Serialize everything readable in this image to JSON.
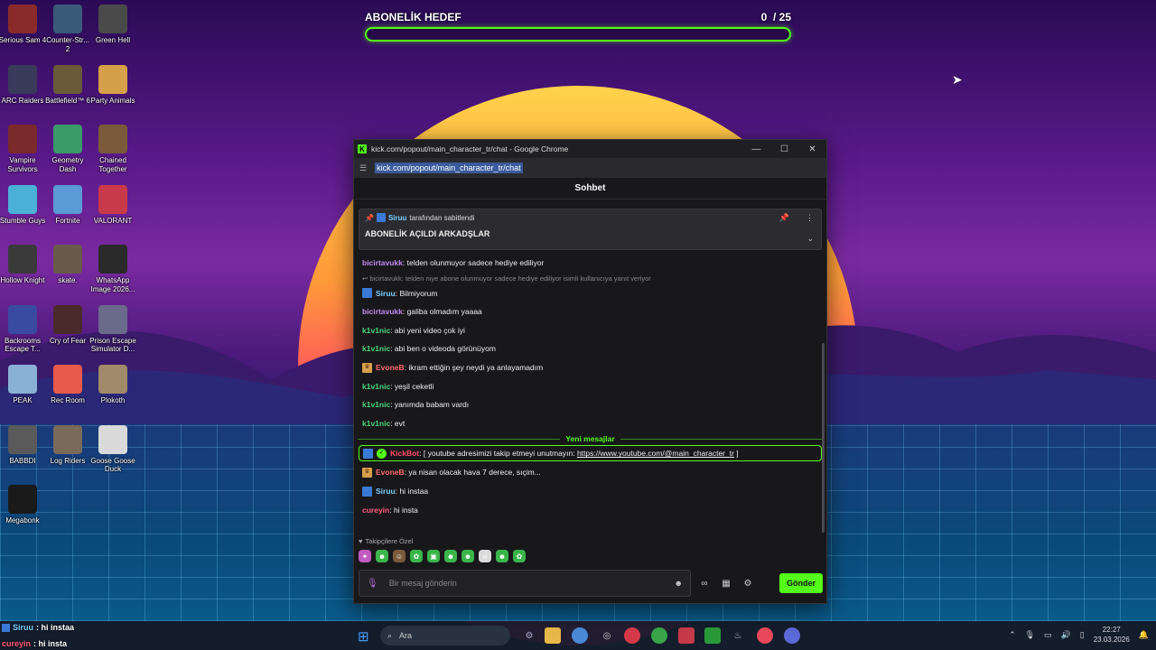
{
  "goal": {
    "title": "ABONELİK HEDEF",
    "current": "0",
    "target": "/ 25",
    "progress": 0
  },
  "desktop_icons": [
    {
      "label": "Serious Sam 4",
      "icon": "serious-sam-icon"
    },
    {
      "label": "Counter-Str... 2",
      "icon": "counter-strike-icon"
    },
    {
      "label": "Green Hell",
      "icon": "green-hell-icon"
    },
    {
      "label": "ARC Raiders",
      "icon": "arc-raiders-icon"
    },
    {
      "label": "Battlefield™ 6",
      "icon": "battlefield-icon"
    },
    {
      "label": "Party Animals",
      "icon": "party-animals-icon"
    },
    {
      "label": "Vampire Survivors",
      "icon": "vampire-survivors-icon"
    },
    {
      "label": "Geometry Dash",
      "icon": "geometry-dash-icon"
    },
    {
      "label": "Chained Together",
      "icon": "chained-together-icon"
    },
    {
      "label": "Stumble Guys",
      "icon": "stumble-guys-icon"
    },
    {
      "label": "Fortnite",
      "icon": "fortnite-icon"
    },
    {
      "label": "VALORANT",
      "icon": "valorant-icon"
    },
    {
      "label": "Hollow Knight",
      "icon": "hollow-knight-icon"
    },
    {
      "label": "skate.",
      "icon": "skate-icon"
    },
    {
      "label": "WhatsApp Image 2026...",
      "icon": "image-file-icon"
    },
    {
      "label": "Backrooms Escape T...",
      "icon": "backrooms-icon"
    },
    {
      "label": "Cry of Fear",
      "icon": "cry-of-fear-icon"
    },
    {
      "label": "Prison Escape Simulator D...",
      "icon": "prison-escape-icon"
    },
    {
      "label": "PEAK",
      "icon": "peak-icon"
    },
    {
      "label": "Rec Room",
      "icon": "rec-room-icon"
    },
    {
      "label": "Plokoth",
      "icon": "plokoth-icon"
    },
    {
      "label": "BABBDI",
      "icon": "babbdi-icon"
    },
    {
      "label": "Log Riders",
      "icon": "log-riders-icon"
    },
    {
      "label": "Goose Goose Duck",
      "icon": "goose-goose-duck-icon"
    },
    {
      "label": "Megabonk",
      "icon": "megabonk-icon"
    }
  ],
  "window": {
    "title": "kick.com/popout/main_character_tr/chat - Google Chrome",
    "url": "kick.com/popout/main_character_tr/chat",
    "chat_header": "Sohbet",
    "pinned": {
      "by_user": "Siruu",
      "by_suffix": "tarafından sabitlendi",
      "message": "ABONELİK AÇILDI ARKADŞLAR"
    },
    "messages": [
      {
        "user": "bicirtavukk",
        "color": "#c08af0",
        "text": ": telden olunmuyor sadece hediye ediliyor"
      },
      {
        "reply": "bicirtavukk: telden niye abone olunmuyor sadece hediye ediliyor isimli kullanıcıya yanıt veriyor"
      },
      {
        "user": "Siruu",
        "color": "#7ad0ff",
        "text": ": Bilmiyorum",
        "badge": "bot"
      },
      {
        "user": "bicirtavukk",
        "color": "#c08af0",
        "text": ": galiba olmadım yaaaa"
      },
      {
        "user": "k1v1nic",
        "color": "#4ad67a",
        "text": ": abi yeni video çok iyi"
      },
      {
        "user": "k1v1nic",
        "color": "#4ad67a",
        "text": ": abi ben o videoda görünüyom"
      },
      {
        "user": "EvoneB",
        "color": "#ff6a6a",
        "text": ": ikram ettiğin şey neydi ya anlayamadım",
        "badge": "crown"
      },
      {
        "user": "k1v1nic",
        "color": "#4ad67a",
        "text": ": yeşil ceketli"
      },
      {
        "user": "k1v1nic",
        "color": "#4ad67a",
        "text": ": yanımda babam vardı"
      },
      {
        "user": "k1v1nic",
        "color": "#4ad67a",
        "text": ": evt"
      }
    ],
    "divider": "Yeni mesajlar",
    "bot_message": {
      "user": "KickBot",
      "text": ": [ youtube adresimizi takip etmeyi unutmayın: ",
      "link": "https://www.youtube.com/@main_character_tr",
      "end": " ]"
    },
    "new_messages": [
      {
        "user": "EvoneB",
        "color": "#ff6a6a",
        "text": ": ya nisan olacak hava 7 derece, sıçim...",
        "badge": "crown"
      },
      {
        "user": "Siruu",
        "color": "#7ad0ff",
        "text": ": hi instaa",
        "badge": "bot"
      },
      {
        "user": "cureyin",
        "color": "#ff5a7a",
        "text": ": hi insta"
      }
    ],
    "emotes_title": "Takipçilere Özel",
    "input_placeholder": "Bir mesaj gönderin",
    "send_label": "Gönder"
  },
  "overlay_chat": [
    {
      "user": "Siruu",
      "text": ": hi instaa",
      "color": "#7ad0ff"
    },
    {
      "user": "cureyin",
      "text": ": hi insta",
      "color": "#ff5a7a"
    }
  ],
  "taskbar": {
    "search_placeholder": "Ara",
    "time": "22:27",
    "date": "23.03.2026"
  }
}
